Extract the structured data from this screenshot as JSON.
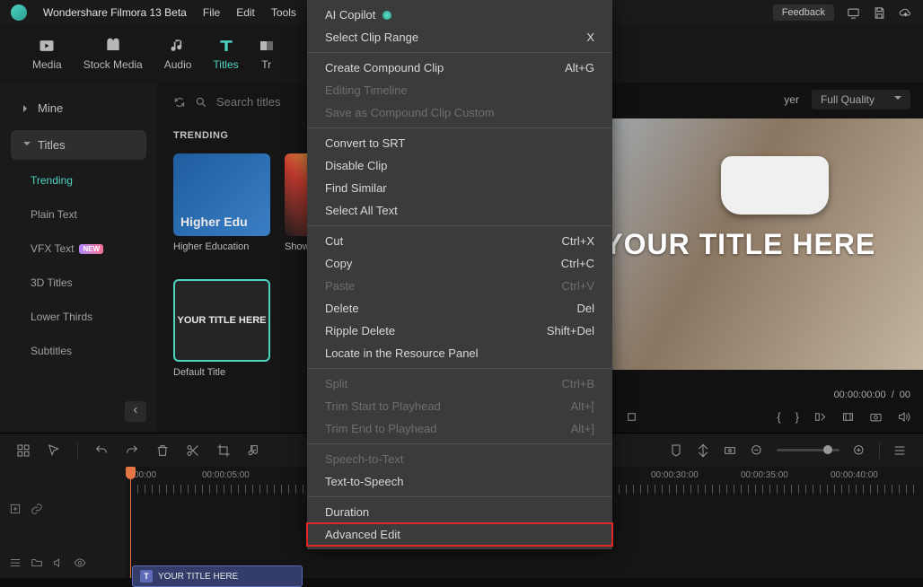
{
  "app": {
    "title": "Wondershare Filmora 13 Beta"
  },
  "menubar": [
    "File",
    "Edit",
    "Tools"
  ],
  "feedback": "Feedback",
  "tabs": [
    {
      "label": "Media"
    },
    {
      "label": "Stock Media"
    },
    {
      "label": "Audio"
    },
    {
      "label": "Titles"
    },
    {
      "label": "Tr"
    }
  ],
  "sidebar": {
    "mine": "Mine",
    "titles": "Titles",
    "subs": [
      "Trending",
      "Plain Text",
      "VFX Text",
      "3D Titles",
      "Lower Thirds",
      "Subtitles"
    ],
    "new_badge": "NEW"
  },
  "search": {
    "placeholder": "Search titles"
  },
  "content": {
    "section": "TRENDING",
    "thumbs": [
      {
        "overlay": "Higher Edu",
        "label": "Higher Education"
      },
      {
        "overlay": "",
        "label": "Show T"
      },
      {
        "overlay": "YOUR TITLE HERE",
        "label": "Default Title"
      }
    ]
  },
  "preview": {
    "player_tab": "yer",
    "quality": "Full Quality",
    "video_text": "YOUR TITLE HERE",
    "time_current": "00:00:00:00",
    "time_sep": "/",
    "time_total": "00"
  },
  "timeline": {
    "ticks": [
      "00:00",
      "00:00:05:00",
      "00:00:30:00",
      "00:00:35:00",
      "00:00:40:00"
    ],
    "clip_label": "YOUR TITLE HERE"
  },
  "context_menu": [
    {
      "label": "AI Copilot",
      "icon": "copilot",
      "type": "item"
    },
    {
      "label": "Select Clip Range",
      "shortcut": "X",
      "type": "item"
    },
    {
      "type": "sep"
    },
    {
      "label": "Create Compound Clip",
      "shortcut": "Alt+G",
      "type": "item"
    },
    {
      "label": "Editing Timeline",
      "type": "item",
      "disabled": true
    },
    {
      "label": "Save as Compound Clip Custom",
      "type": "item",
      "disabled": true
    },
    {
      "type": "sep"
    },
    {
      "label": "Convert to SRT",
      "type": "item"
    },
    {
      "label": "Disable Clip",
      "type": "item"
    },
    {
      "label": "Find Similar",
      "type": "item"
    },
    {
      "label": "Select All Text",
      "type": "item"
    },
    {
      "type": "sep"
    },
    {
      "label": "Cut",
      "shortcut": "Ctrl+X",
      "type": "item"
    },
    {
      "label": "Copy",
      "shortcut": "Ctrl+C",
      "type": "item"
    },
    {
      "label": "Paste",
      "shortcut": "Ctrl+V",
      "type": "item",
      "disabled": true
    },
    {
      "label": "Delete",
      "shortcut": "Del",
      "type": "item"
    },
    {
      "label": "Ripple Delete",
      "shortcut": "Shift+Del",
      "type": "item"
    },
    {
      "label": "Locate in the Resource Panel",
      "type": "item"
    },
    {
      "type": "sep"
    },
    {
      "label": "Split",
      "shortcut": "Ctrl+B",
      "type": "item",
      "disabled": true
    },
    {
      "label": "Trim Start to Playhead",
      "shortcut": "Alt+[",
      "type": "item",
      "disabled": true
    },
    {
      "label": "Trim End to Playhead",
      "shortcut": "Alt+]",
      "type": "item",
      "disabled": true
    },
    {
      "type": "sep"
    },
    {
      "label": "Speech-to-Text",
      "type": "item",
      "disabled": true
    },
    {
      "label": "Text-to-Speech",
      "type": "item"
    },
    {
      "type": "sep"
    },
    {
      "label": "Duration",
      "type": "item"
    },
    {
      "label": "Advanced Edit",
      "type": "item",
      "highlight": true
    }
  ]
}
